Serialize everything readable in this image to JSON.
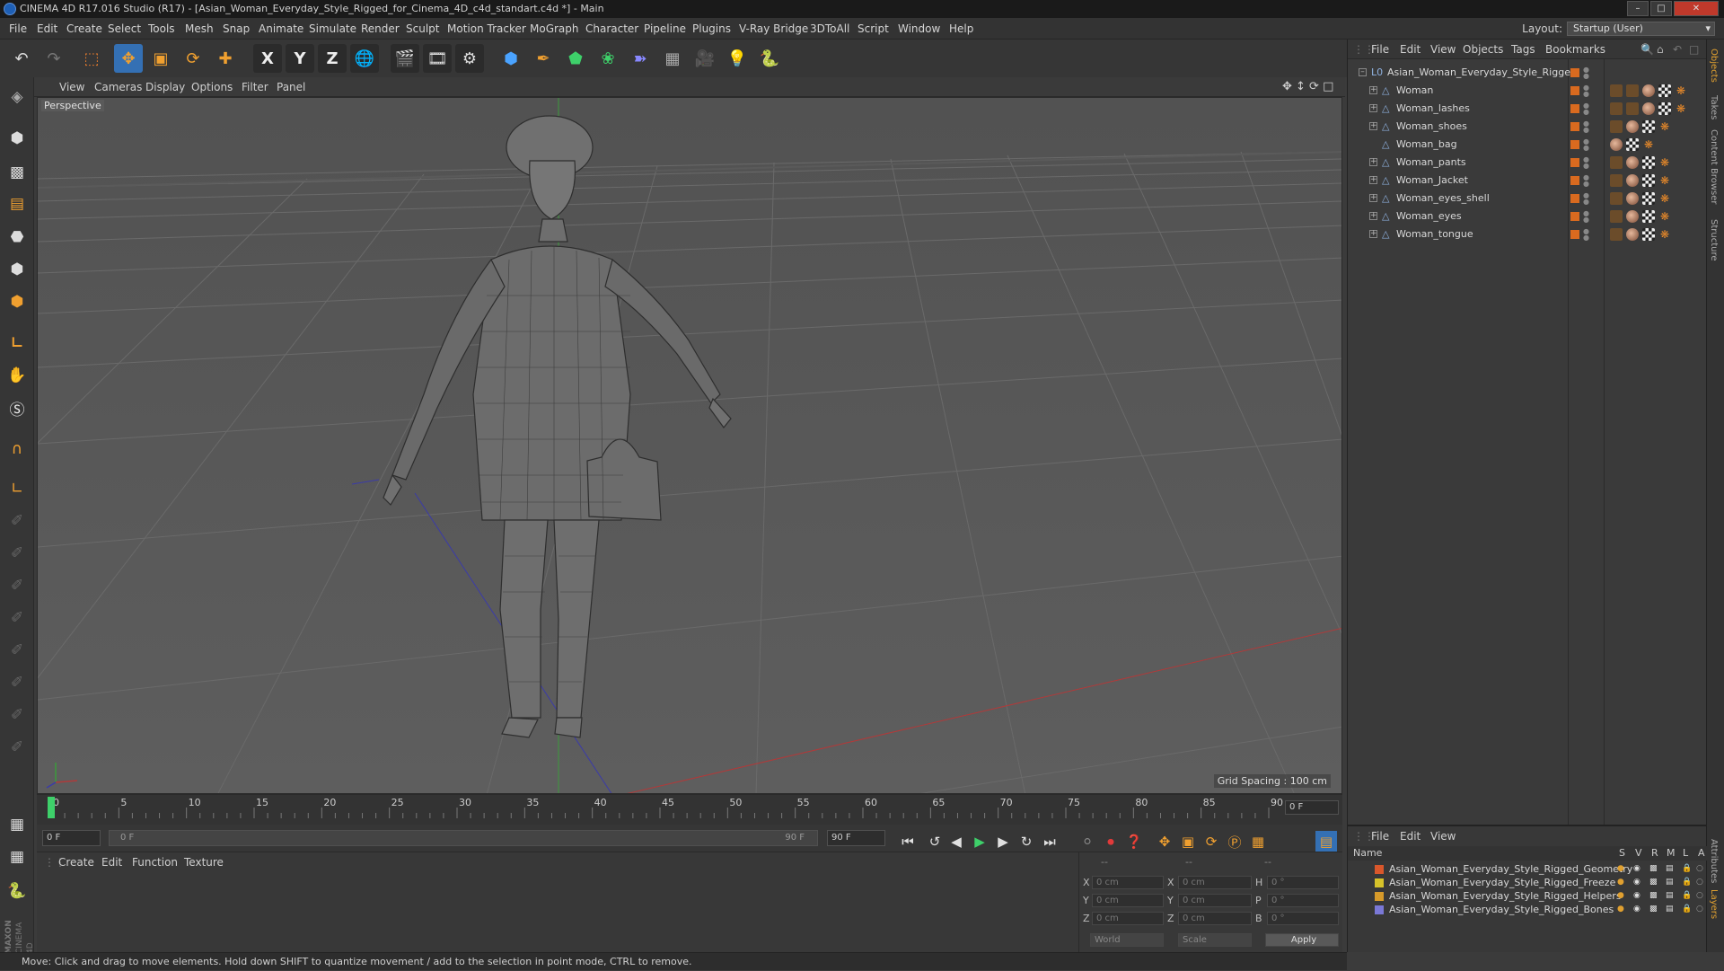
{
  "window": {
    "title": "CINEMA 4D R17.016 Studio (R17) - [Asian_Woman_Everyday_Style_Rigged_for_Cinema_4D_c4d_standart.c4d *] - Main"
  },
  "menubar": {
    "items": [
      "File",
      "Edit",
      "Create",
      "Select",
      "Tools",
      "Mesh",
      "Snap",
      "Animate",
      "Simulate",
      "Render",
      "Sculpt",
      "Motion Tracker",
      "MoGraph",
      "Character",
      "Pipeline",
      "Plugins",
      "V-Ray Bridge",
      "3DToAll",
      "Script",
      "Window",
      "Help"
    ],
    "layout_label": "Layout:",
    "layout_value": "Startup (User)"
  },
  "toolbar": {
    "axis_labels": [
      "X",
      "Y",
      "Z"
    ]
  },
  "viewport": {
    "menu": [
      "View",
      "Cameras",
      "Display",
      "Options",
      "Filter",
      "Panel"
    ],
    "label": "Perspective",
    "grid_spacing": "Grid Spacing : 100 cm"
  },
  "timeline": {
    "ticks": [
      "0",
      "5",
      "10",
      "15",
      "20",
      "25",
      "30",
      "35",
      "40",
      "45",
      "50",
      "55",
      "60",
      "65",
      "70",
      "75",
      "80",
      "85",
      "90"
    ],
    "current_frame": "0 F",
    "start_field": "0 F",
    "range_start": "0 F",
    "range_end": "90 F",
    "end_field": "90 F",
    "playhead_fraction": 0.0
  },
  "material_panel": {
    "menu": [
      "Create",
      "Edit",
      "Function",
      "Texture"
    ]
  },
  "coordinates": {
    "header": [
      "--",
      "--",
      "--"
    ],
    "rows": [
      {
        "axis": "X",
        "pos": "0 cm",
        "axis2": "X",
        "size": "0 cm",
        "rot_label": "H",
        "rot": "0 °"
      },
      {
        "axis": "Y",
        "pos": "0 cm",
        "axis2": "Y",
        "size": "0 cm",
        "rot_label": "P",
        "rot": "0 °"
      },
      {
        "axis": "Z",
        "pos": "0 cm",
        "axis2": "Z",
        "size": "0 cm",
        "rot_label": "B",
        "rot": "0 °"
      }
    ],
    "mode_world": "World",
    "mode_scale": "Scale",
    "apply": "Apply"
  },
  "status": {
    "text": "Move: Click and drag to move elements. Hold down SHIFT to quantize movement / add to the selection in point mode, CTRL to remove."
  },
  "objects_panel": {
    "menu": [
      "File",
      "Edit",
      "View",
      "Objects",
      "Tags",
      "Bookmarks"
    ],
    "root": "Asian_Woman_Everyday_Style_Rigged",
    "children": [
      "Woman",
      "Woman_lashes",
      "Woman_shoes",
      "Woman_bag",
      "Woman_pants",
      "Woman_Jacket",
      "Woman_eyes_shell",
      "Woman_eyes",
      "Woman_tongue"
    ]
  },
  "side_tabs": [
    "Objects",
    "Takes",
    "Content Browser",
    "Structure"
  ],
  "side_tabs_lower": [
    "Attributes",
    "Layers"
  ],
  "layers_panel": {
    "menu": [
      "File",
      "Edit",
      "View"
    ],
    "head_name": "Name",
    "head_cols": [
      "S",
      "V",
      "R",
      "M",
      "L",
      "A"
    ],
    "layers": [
      {
        "name": "Asian_Woman_Everyday_Style_Rigged_Geometry",
        "color": "#d9572b"
      },
      {
        "name": "Asian_Woman_Everyday_Style_Rigged_Freeze",
        "color": "#d6c22a"
      },
      {
        "name": "Asian_Woman_Everyday_Style_Rigged_Helpers",
        "color": "#d69a2a"
      },
      {
        "name": "Asian_Woman_Everyday_Style_Rigged_Bones",
        "color": "#7a78d6"
      }
    ]
  },
  "brand": {
    "maxon": "MAXON",
    "cinema": "CINEMA 4D"
  }
}
